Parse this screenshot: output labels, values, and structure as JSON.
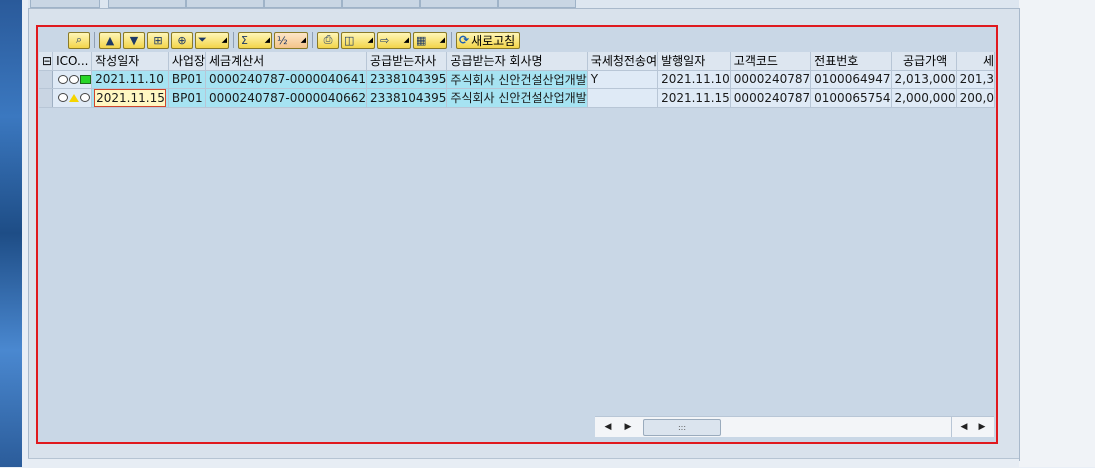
{
  "toolbar": {
    "refresh_label": "새로고침"
  },
  "grid": {
    "columns": [
      "",
      "ICO...",
      "작성일자",
      "사업장",
      "세금계산서",
      "공급받는자사",
      "공급받는자 회사명",
      "국세청전송여",
      "발행일자",
      "고객코드",
      "전표번호",
      "공급가액",
      "세"
    ],
    "rows": [
      {
        "status": "green",
        "작성일자": "2021.11.10",
        "사업장": "BP01",
        "세금계산서": "0000240787-0000040641",
        "공급받는자사": "2338104395",
        "회사명": "주식회사 신안건설산업개발",
        "국세청전송여": "Y",
        "발행일자": "2021.11.10",
        "고객코드": "0000240787",
        "전표번호": "0100064947",
        "공급가액": "2,013,000",
        "세액": "201,3"
      },
      {
        "status": "yellow",
        "작성일자": "2021.11.15",
        "사업장": "BP01",
        "세금계산서": "0000240787-0000040662",
        "공급받는자사": "2338104395",
        "회사명": "주식회사 신안건설산업개발",
        "국세청전송여": "",
        "발행일자": "2021.11.15",
        "고객코드": "0000240787",
        "전표번호": "0100065754",
        "공급가액": "2,000,000",
        "세액": "200,0"
      }
    ]
  },
  "scrollbar": {
    "thumb_grip": ":::"
  },
  "colors": {
    "frame": "#e0191e",
    "key_cell": "#a6e3f2",
    "toolbar_button": "#f3d54a"
  }
}
